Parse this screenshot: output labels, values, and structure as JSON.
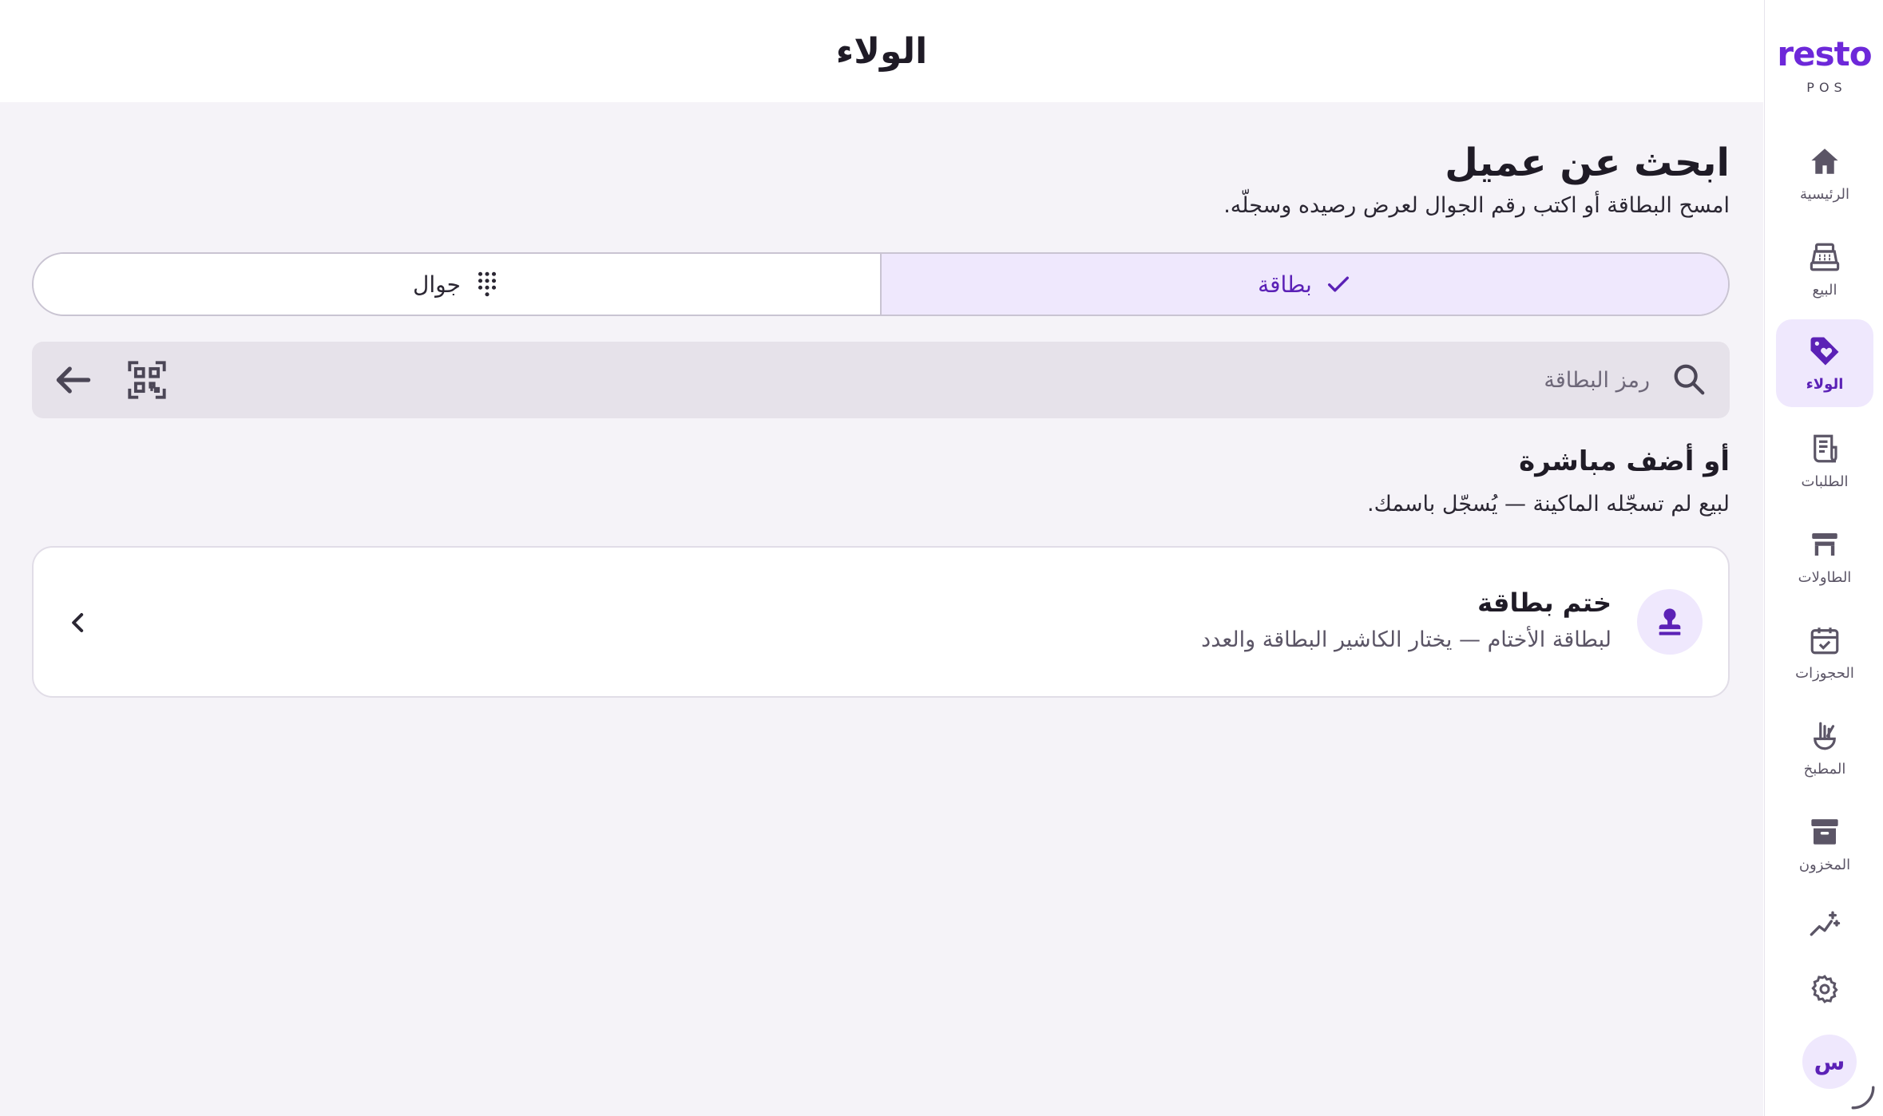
{
  "header": {
    "title": "الولاء"
  },
  "brand": {
    "name": "resto",
    "sub": "POS"
  },
  "sidebar": {
    "items": [
      {
        "label": "الرئيسية",
        "icon": "home-icon"
      },
      {
        "label": "البيع",
        "icon": "cash-register-icon"
      },
      {
        "label": "الولاء",
        "icon": "loyalty-tag-icon",
        "active": true
      },
      {
        "label": "الطلبات",
        "icon": "receipt-icon"
      },
      {
        "label": "الطاولات",
        "icon": "table-icon"
      },
      {
        "label": "الحجوزات",
        "icon": "calendar-check-icon"
      },
      {
        "label": "المطبخ",
        "icon": "kitchen-icon"
      },
      {
        "label": "المخزون",
        "icon": "archive-icon"
      }
    ],
    "extra_icons": [
      "analytics-sparkle-icon",
      "settings-icon"
    ],
    "avatar": "س"
  },
  "main": {
    "title": "ابحث عن عميل",
    "subtitle": "امسح البطاقة أو اكتب رقم الجوال لعرض رصيده وسجلّه.",
    "tabs": [
      {
        "label": "بطاقة",
        "icon": "check-icon",
        "active": true
      },
      {
        "label": "جوال",
        "icon": "dialpad-icon",
        "active": false
      }
    ],
    "search": {
      "placeholder": "رمز البطاقة",
      "value": ""
    },
    "direct": {
      "title": "أو أضف مباشرة",
      "subtitle": "لبيع لم تسجّله الماكينة — يُسجّل باسمك."
    },
    "card": {
      "title": "ختم بطاقة",
      "subtitle": "لبطاقة الأختام — يختار الكاشير البطاقة والعدد",
      "icon": "stamp-icon"
    }
  },
  "colors": {
    "accent": "#5b21b6",
    "brand": "#6d28d9",
    "accent_bg": "#efe8fd",
    "page_bg": "#f5f3f8"
  }
}
